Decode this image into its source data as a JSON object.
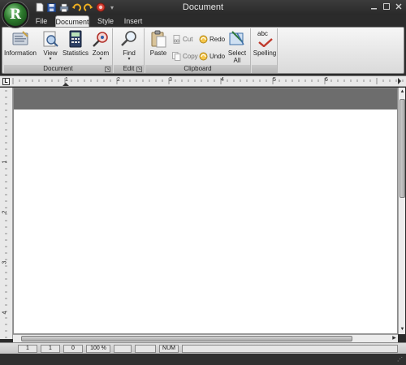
{
  "window": {
    "title": "Document"
  },
  "app_button": {
    "letter": "R"
  },
  "quick_access": [
    "new-icon",
    "save-icon",
    "print-icon",
    "undo-icon",
    "redo-icon",
    "record-icon",
    "customize-icon"
  ],
  "tabs": [
    {
      "label": "File",
      "active": false
    },
    {
      "label": "Document",
      "active": true
    },
    {
      "label": "Style",
      "active": false
    },
    {
      "label": "Insert",
      "active": false
    }
  ],
  "ribbon": {
    "groups": {
      "document": {
        "caption": "Document",
        "buttons": {
          "information": "Information",
          "view": "View",
          "statistics": "Statistics",
          "zoom": "Zoom"
        }
      },
      "edit": {
        "caption": "Edit",
        "buttons": {
          "find": "Find"
        }
      },
      "clipboard": {
        "caption": "Clipboard",
        "buttons": {
          "paste": "Paste",
          "cut": "Cut",
          "copy": "Copy",
          "redo": "Redo",
          "undo": "Undo",
          "select_all_line1": "Select",
          "select_all_line2": "All"
        }
      },
      "proofing": {
        "buttons": {
          "spelling": "Spelling",
          "spelling_icon_text": "abc"
        }
      }
    }
  },
  "ruler": {
    "corner": "L",
    "numbers": [
      "1",
      "2",
      "3",
      "4",
      "5",
      "6"
    ]
  },
  "vruler": {
    "numbers": [
      "1",
      "2",
      "3",
      "4"
    ]
  },
  "status": {
    "cells": [
      "1",
      "1",
      "0",
      "100 %",
      "",
      "",
      "NUM",
      ""
    ]
  },
  "colors": {
    "frame": "#2b2b2b",
    "ribbon_bg": "#e6e6e6",
    "doc_header": "#6d6d6d",
    "orb_green": "#2d7a2d"
  }
}
